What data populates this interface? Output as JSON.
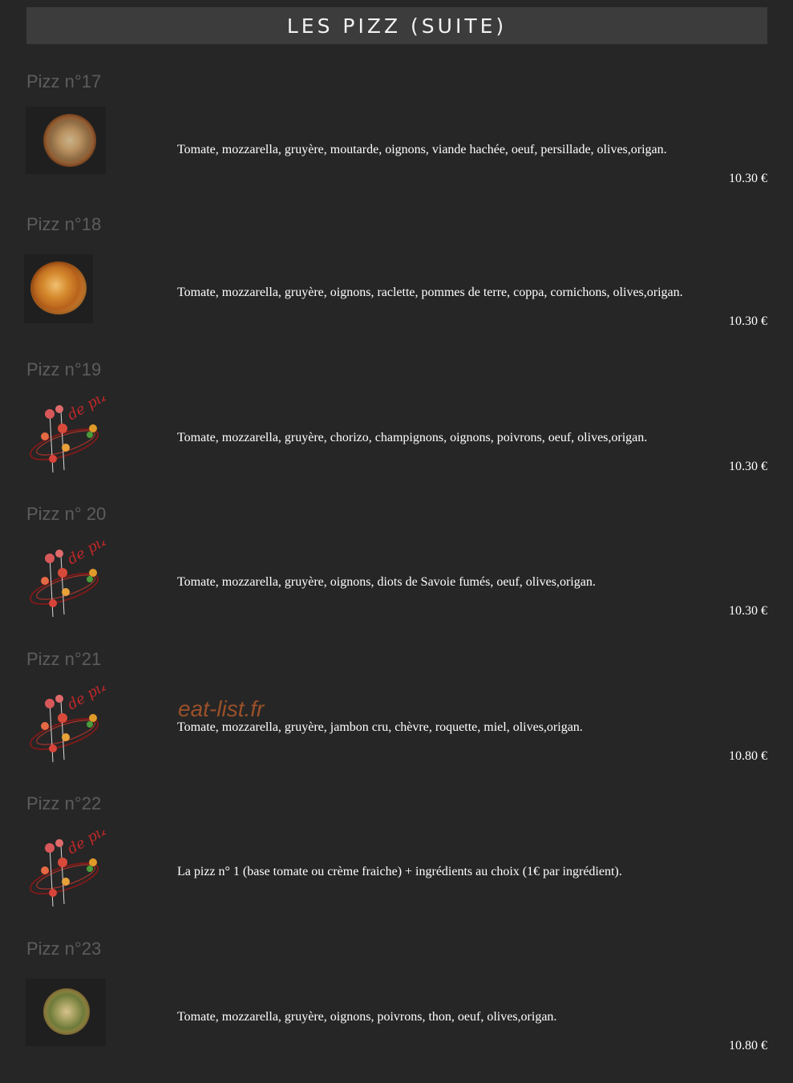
{
  "header": {
    "title": "LES PIZZ (SUITE)"
  },
  "watermark": "eat-list.fr",
  "items": [
    {
      "name": "Pizz n°17",
      "image": "pizza-photo",
      "description": "Tomate, mozzarella, gruyère, moutarde, oignons, viande hachée, oeuf, persillade, olives,origan.",
      "price": "10.30 €"
    },
    {
      "name": "Pizz n°18",
      "image": "pizza-photo",
      "description": "Tomate, mozzarella, gruyère, oignons, raclette, pommes de terre, coppa, cornichons, olives,origan.",
      "price": "10.30 €"
    },
    {
      "name": "Pizz n°19",
      "image": "restaurant-logo",
      "description": "Tomate, mozzarella, gruyère, chorizo, champignons, oignons, poivrons, oeuf, olives,origan.",
      "price": "10.30 €"
    },
    {
      "name": "Pizz n° 20",
      "image": "restaurant-logo",
      "description": "Tomate, mozzarella, gruyère, oignons, diots de Savoie fumés, oeuf, olives,origan.",
      "price": "10.30 €"
    },
    {
      "name": "Pizz n°21",
      "image": "restaurant-logo",
      "description": "Tomate, mozzarella, gruyère, jambon cru, chèvre, roquette, miel, olives,origan.",
      "price": "10.80 €"
    },
    {
      "name": "Pizz n°22",
      "image": "restaurant-logo",
      "description": "La pizz n° 1 (base tomate ou crème fraiche) + ingrédients au choix (1€ par ingrédient).",
      "price": ""
    },
    {
      "name": "Pizz n°23",
      "image": "pizza-photo",
      "description": "Tomate, mozzarella, gruyère, oignons, poivrons, thon, oeuf, olives,origan.",
      "price": "10.80 €"
    }
  ]
}
